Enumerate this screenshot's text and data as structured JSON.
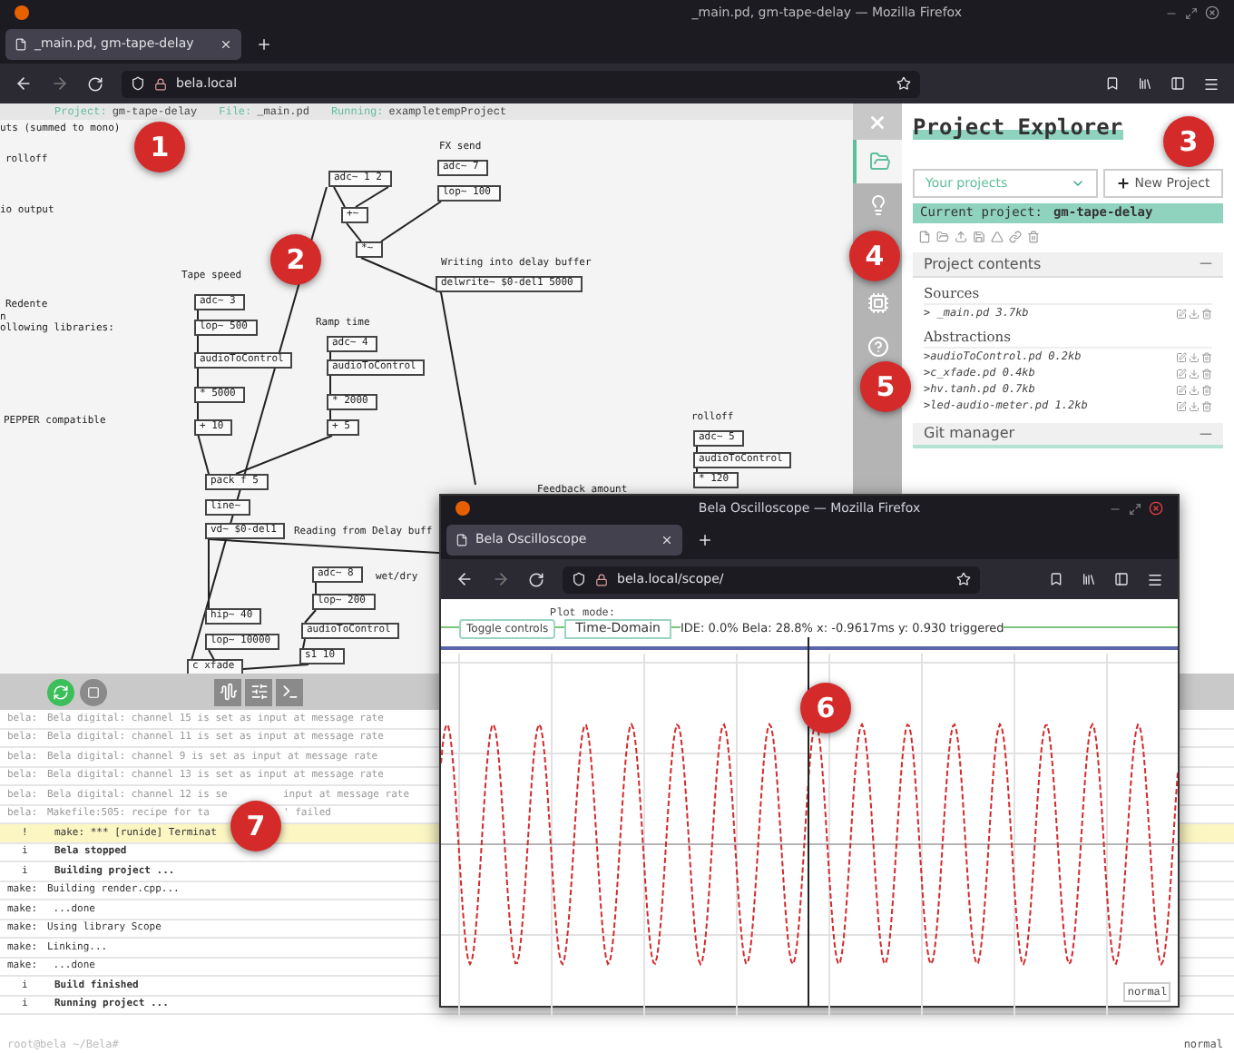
{
  "browser": {
    "title": "_main.pd, gm-tape-delay — Mozilla Firefox",
    "tab": {
      "label": "_main.pd, gm-tape-delay",
      "selected": true
    },
    "url": "bela.local"
  },
  "ide_header": {
    "project_label": "Project:",
    "project": "gm-tape-delay",
    "file_label": "File:",
    "file": "_main.pd",
    "running_label": "Running:",
    "running": "exampletempProject"
  },
  "patch": {
    "comments": [
      "uts (summed to mono)",
      "rolloff",
      "io output",
      "FX send",
      "Writing into delay buffer",
      "Tape speed",
      "Redente",
      "n",
      "ollowing libraries:",
      "Ramp time",
      "PEPPER compatible",
      "rolloff",
      "Feedback amount",
      "Reading from Delay buff",
      "wet/dry"
    ],
    "objects": [
      "adc~ 1 2",
      "+~",
      "*~",
      "adc~ 7",
      "lop~ 100",
      "delwrite~ $0-del1 5000",
      "adc~ 3",
      "lop~ 500",
      "audioToControl",
      "* 5000",
      "+ 10",
      "adc~ 4",
      "audioToControl",
      "* 2000",
      "+ 5",
      "pack f 5",
      "line~",
      "vd~ $0-del1",
      "adc~ 8",
      "lop~ 200",
      "audioToControl",
      "s1 10",
      "hip~ 40",
      "lop~ 10000",
      "c xfade",
      "adc~ 5",
      "audioToControl",
      "* 120"
    ]
  },
  "sidebar_tabs": [
    {
      "selected": true
    },
    {
      "selected": false
    },
    {
      "selected": false
    },
    {
      "selected": false
    }
  ],
  "explorer": {
    "title": "Project Explorer",
    "project_select": "Your projects",
    "new_project": "New Project",
    "current_project_label": "Current project:",
    "current_project": "gm-tape-delay",
    "sections": [
      {
        "title": "Project contents",
        "toggle": "—",
        "expanded": true,
        "groups": [
          {
            "title": "Sources",
            "files": [
              "> _main.pd 3.7kb"
            ]
          },
          {
            "title": "Abstractions",
            "files": [
              ">audioToControl.pd 0.2kb",
              ">c_xfade.pd 0.4kb",
              ">hv.tanh.pd 0.7kb",
              ">led-audio-meter.pd 1.2kb"
            ]
          }
        ]
      },
      {
        "title": "Git manager",
        "toggle": "—",
        "expanded": false
      }
    ]
  },
  "console": {
    "rows": [
      {
        "kind": "message",
        "source": "bela:",
        "message": "Bela digital: channel 15 is set as input at message rate"
      },
      {
        "kind": "message",
        "source": "bela:",
        "message": "Bela digital: channel 11 is set as input at message rate"
      },
      {
        "kind": "message",
        "source": "bela:",
        "message": "Bela digital: channel 9 is set as input at message rate"
      },
      {
        "kind": "message",
        "source": "bela:",
        "message": "Bela digital: channel 13 is set as input at message rate"
      },
      {
        "kind": "message",
        "source": "bela:",
        "message": "Bela digital: channel 12 is se",
        "tail": "input at message rate"
      },
      {
        "kind": "message",
        "source": "bela:",
        "message": "Makefile:505: recipe for ta",
        "tail": "' failed"
      },
      {
        "kind": "warning",
        "source": "!",
        "message": "make: *** [runide] Terminat"
      },
      {
        "kind": "status",
        "source": "i",
        "message": "Bela stopped"
      },
      {
        "kind": "status",
        "source": "i",
        "message": "Building project ..."
      },
      {
        "kind": "make",
        "source": "make:",
        "message": "Building render.cpp..."
      },
      {
        "kind": "make",
        "source": "make:",
        "message": " ...done"
      },
      {
        "kind": "make",
        "source": "make:",
        "message": "Using library Scope"
      },
      {
        "kind": "make",
        "source": "make:",
        "message": "Linking..."
      },
      {
        "kind": "make",
        "source": "make:",
        "message": " ...done"
      },
      {
        "kind": "status",
        "source": "i",
        "message": "Build finished"
      },
      {
        "kind": "status",
        "source": "i",
        "message": "Running project ..."
      }
    ],
    "prompt": "root@bela ~/Bela#",
    "mode": "normal"
  },
  "scope_window": {
    "title": "Bela Oscilloscope — Mozilla Firefox",
    "tab": {
      "label": "Bela Oscilloscope",
      "selected": true
    },
    "url": "bela.local/scope/",
    "plot_mode_label": "Plot mode:",
    "toggle_controls": "Toggle controls",
    "plot_mode": "Time-Domain",
    "status": "IDE: 0.0% Bela: 28.8% x: -0.9617ms y: 0.930 triggered",
    "mode": "normal"
  },
  "callouts": [
    "1",
    "2",
    "3",
    "4",
    "5",
    "6",
    "7"
  ]
}
